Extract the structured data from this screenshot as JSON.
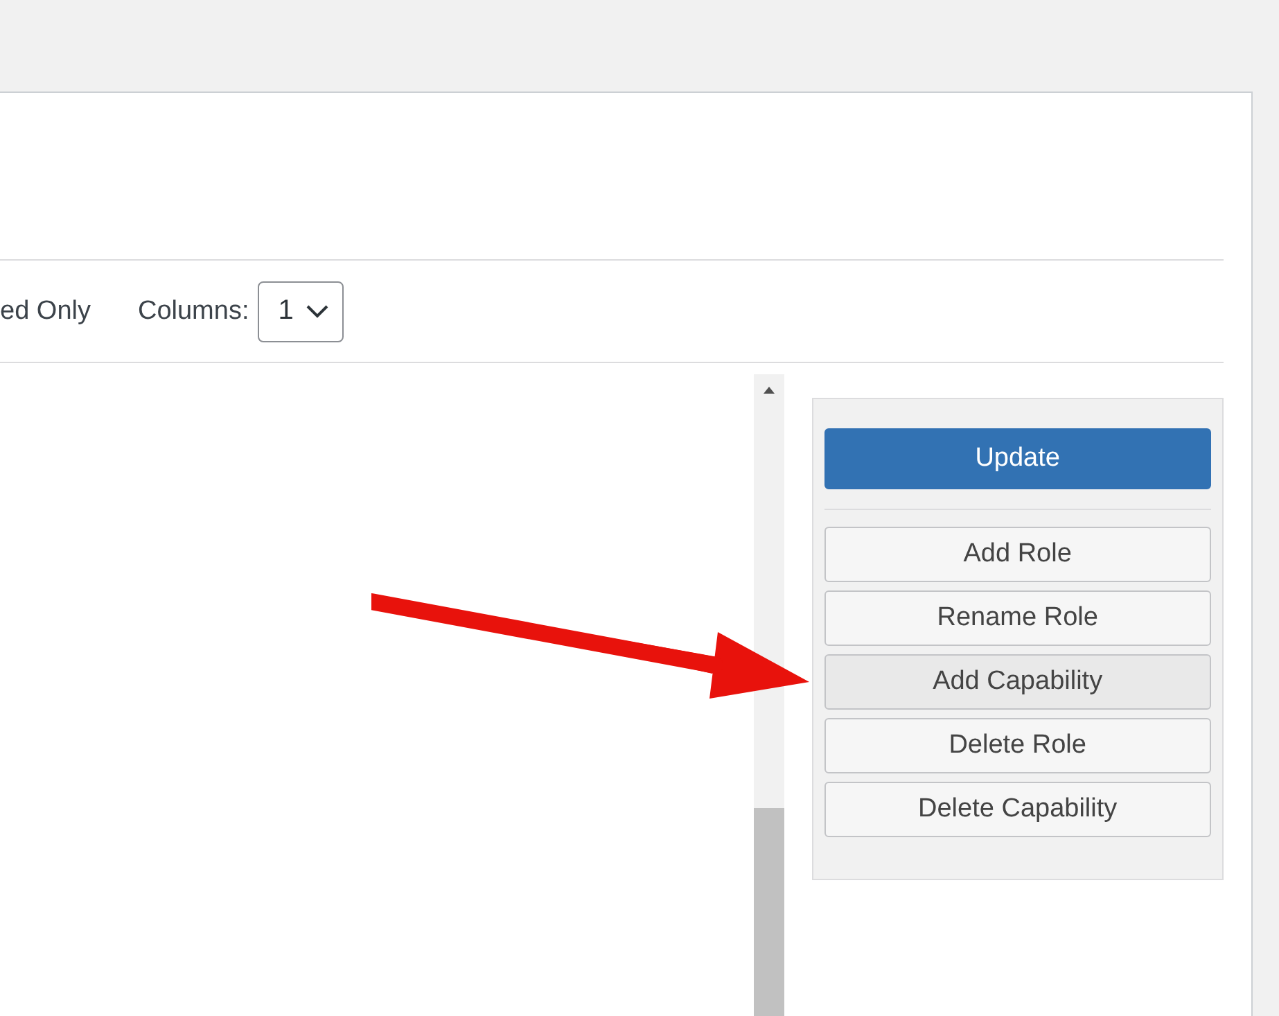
{
  "toolbar": {
    "filter_label": "ed Only",
    "columns_label": "Columns:",
    "columns_value": "1"
  },
  "sidebar": {
    "buttons": [
      {
        "label": "Update",
        "kind": "primary",
        "selected": false
      },
      {
        "label": "Add Role",
        "kind": "default",
        "selected": false
      },
      {
        "label": "Rename Role",
        "kind": "default",
        "selected": false
      },
      {
        "label": "Add Capability",
        "kind": "default",
        "selected": true
      },
      {
        "label": "Delete Role",
        "kind": "default",
        "selected": false
      },
      {
        "label": "Delete Capability",
        "kind": "default",
        "selected": false
      }
    ]
  }
}
